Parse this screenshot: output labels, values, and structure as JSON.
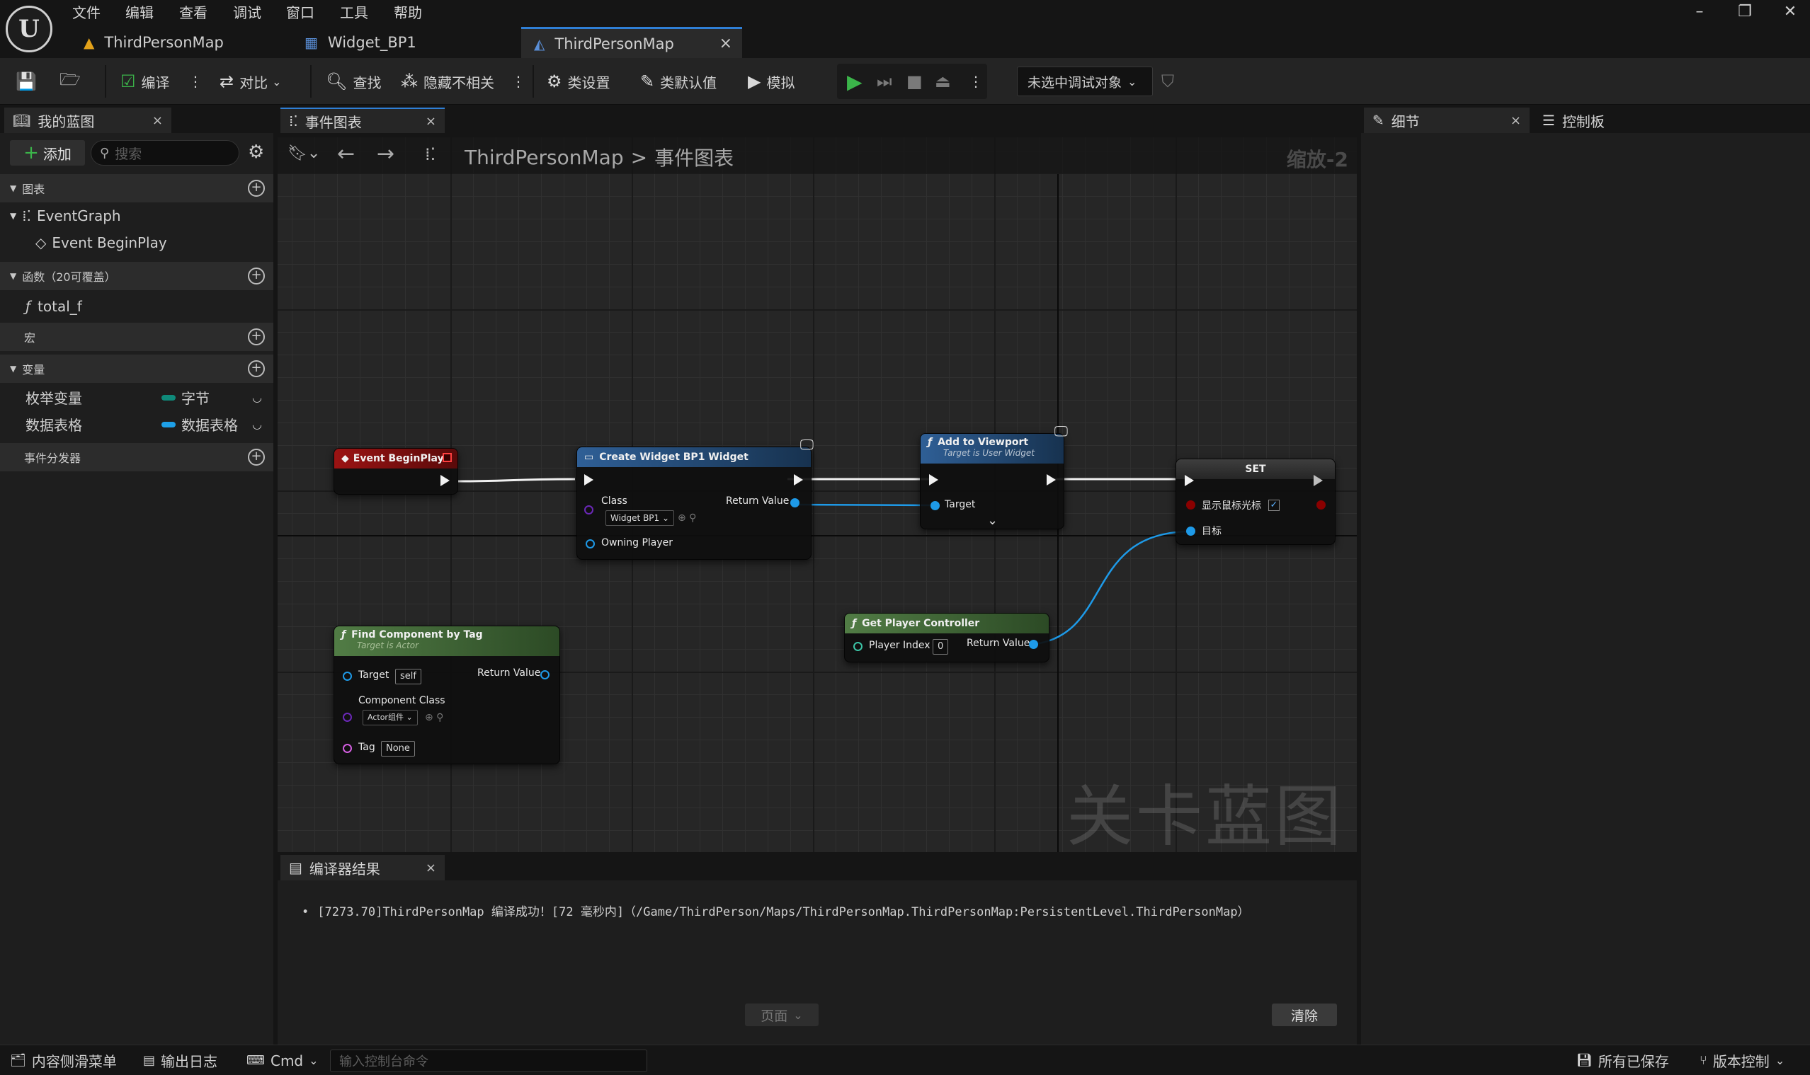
{
  "menu": [
    "文件",
    "编辑",
    "查看",
    "调试",
    "窗口",
    "工具",
    "帮助"
  ],
  "logo_icon": "unreal-logo-icon",
  "doc_tabs": [
    {
      "label": "ThirdPersonMap"
    },
    {
      "label": "Widget_BP1"
    },
    {
      "label": "ThirdPersonMap",
      "close": "×"
    }
  ],
  "window_controls": {
    "minimize": "–",
    "restore": "❐",
    "close": "✕"
  },
  "toolbar": {
    "compile": "编译",
    "diff": "对比",
    "find": "查找",
    "hide_unrelated": "隐藏不相关",
    "class_settings": "类设置",
    "class_defaults": "类默认值",
    "simulate": "模拟",
    "debug_target": "未选中调试对象"
  },
  "my_blueprint": {
    "tab": "我的蓝图",
    "close": "×",
    "add": "添加",
    "search_placeholder": "搜索",
    "graphs_header": "图表",
    "event_graph": "EventGraph",
    "event_begin_play": "Event BeginPlay",
    "functions_header": "函数（20可覆盖）",
    "function_total": "total_f",
    "macros_header": "宏",
    "variables_header": "变量",
    "variables": [
      {
        "name": "枚举变量",
        "type": "字节",
        "color": "#0f8a7a"
      },
      {
        "name": "数据表格",
        "type": "数据表格",
        "color": "#1ea0e8"
      }
    ],
    "dispatchers_header": "事件分发器"
  },
  "graph_tab": {
    "label": "事件图表",
    "close": "×"
  },
  "breadcrumb": {
    "map": "ThirdPersonMap",
    "sep": ">",
    "graph": "事件图表"
  },
  "zoom": "缩放-2",
  "watermark": "关卡蓝图",
  "nodes": {
    "begin_play": {
      "title": "Event BeginPlay"
    },
    "create_widget": {
      "title": "Create Widget BP1 Widget",
      "class_label": "Class",
      "class_value": "Widget BP1",
      "return_value": "Return Value",
      "owning_player": "Owning Player"
    },
    "add_to_viewport": {
      "title": "Add to Viewport",
      "subtitle": "Target is User Widget",
      "target": "Target"
    },
    "set": {
      "title": "SET",
      "show_cursor": "显示鼠标光标",
      "target": "目标"
    },
    "find_component": {
      "title": "Find Component by Tag",
      "subtitle": "Target is Actor",
      "target": "Target",
      "target_value": "self",
      "return_value": "Return Value",
      "component_class": "Component Class",
      "component_value": "Actor组件",
      "tag": "Tag",
      "tag_value": "None"
    },
    "get_player_controller": {
      "title": "Get Player Controller",
      "player_index": "Player Index",
      "player_index_value": "0",
      "return_value": "Return Value"
    }
  },
  "compiler": {
    "tab": "编译器结果",
    "close": "×",
    "message": "[7273.70]ThirdPersonMap 编译成功！[72 毫秒内]（/Game/ThirdPerson/Maps/ThirdPersonMap.ThirdPersonMap:PersistentLevel.ThirdPersonMap）",
    "page": "页面",
    "clear": "清除"
  },
  "right_tabs": {
    "details": "细节",
    "details_close": "×",
    "palette": "控制板"
  },
  "statusbar": {
    "content_drawer": "内容侧滑菜单",
    "output_log": "输出日志",
    "cmd": "Cmd",
    "console_placeholder": "输入控制台命令",
    "all_saved": "所有已保存",
    "source_control": "版本控制"
  },
  "colors": {
    "accent": "#2f7fd6",
    "event_head": "#8c1010",
    "function_head": "#2b5a8c",
    "pure_head": "#4b7a3e",
    "set_head": "#3a3a3a",
    "play": "#3bb54a"
  }
}
